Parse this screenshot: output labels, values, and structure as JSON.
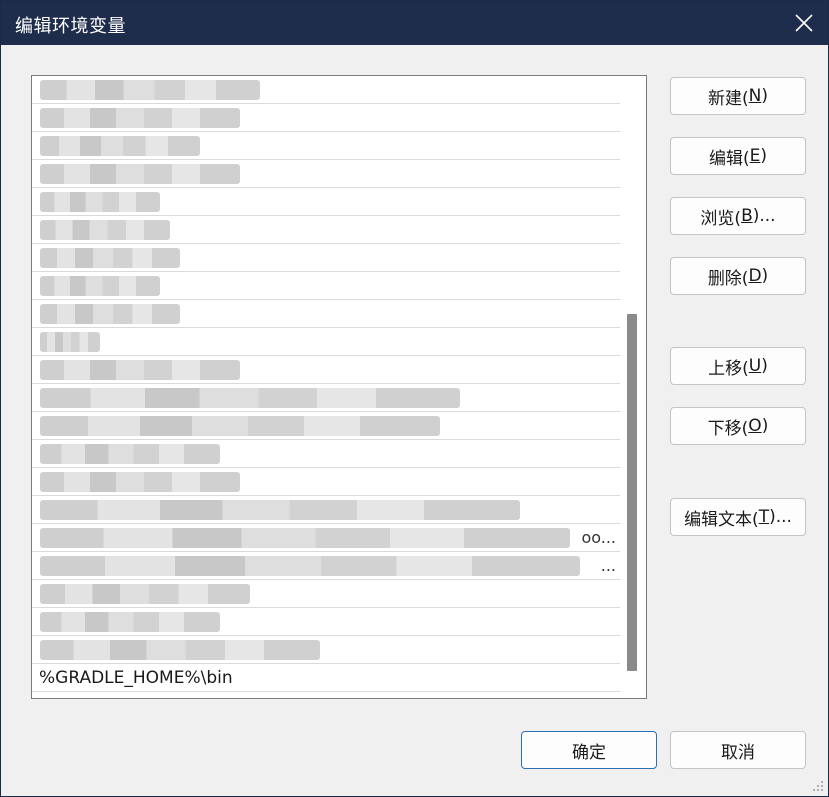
{
  "window": {
    "title": "编辑环境变量"
  },
  "list": {
    "visible_rows": [
      {
        "text": "",
        "blur": 220
      },
      {
        "text": "",
        "blur": 200
      },
      {
        "text": "",
        "blur": 160
      },
      {
        "text": "",
        "blur": 200
      },
      {
        "text": "",
        "blur": 120
      },
      {
        "text": "",
        "blur": 130
      },
      {
        "text": "",
        "blur": 140
      },
      {
        "text": "",
        "blur": 120
      },
      {
        "text": "",
        "blur": 140
      },
      {
        "text": "",
        "blur": 60
      },
      {
        "text": "",
        "blur": 200
      },
      {
        "text": "",
        "blur": 420
      },
      {
        "text": "",
        "blur": 400
      },
      {
        "text": "",
        "blur": 180
      },
      {
        "text": "",
        "blur": 200
      },
      {
        "text": "",
        "blur": 480,
        "trail": ""
      },
      {
        "text": "",
        "blur": 530,
        "trail": "oo..."
      },
      {
        "text": "",
        "blur": 540,
        "trail": "..."
      },
      {
        "text": "",
        "blur": 210
      },
      {
        "text": "",
        "blur": 180
      },
      {
        "text": "",
        "blur": 280
      },
      {
        "text": "%GRADLE_HOME%\\bin",
        "blur": 0
      }
    ]
  },
  "buttons": {
    "new": {
      "label": "新建(",
      "key": "N",
      "end": ")"
    },
    "edit": {
      "label": "编辑(",
      "key": "E",
      "end": ")"
    },
    "browse": {
      "label": "浏览(",
      "key": "B",
      "end": ")..."
    },
    "delete": {
      "label": "删除(",
      "key": "D",
      "end": ")"
    },
    "move_up": {
      "label": "上移(",
      "key": "U",
      "end": ")"
    },
    "move_down": {
      "label": "下移(",
      "key": "O",
      "end": ")"
    },
    "edit_text": {
      "label": "编辑文本(",
      "key": "T",
      "end": ")..."
    },
    "ok": "确定",
    "cancel": "取消"
  },
  "colors": {
    "titlebar": "#1f2d4c",
    "accent_border": "#2d6fb3"
  }
}
